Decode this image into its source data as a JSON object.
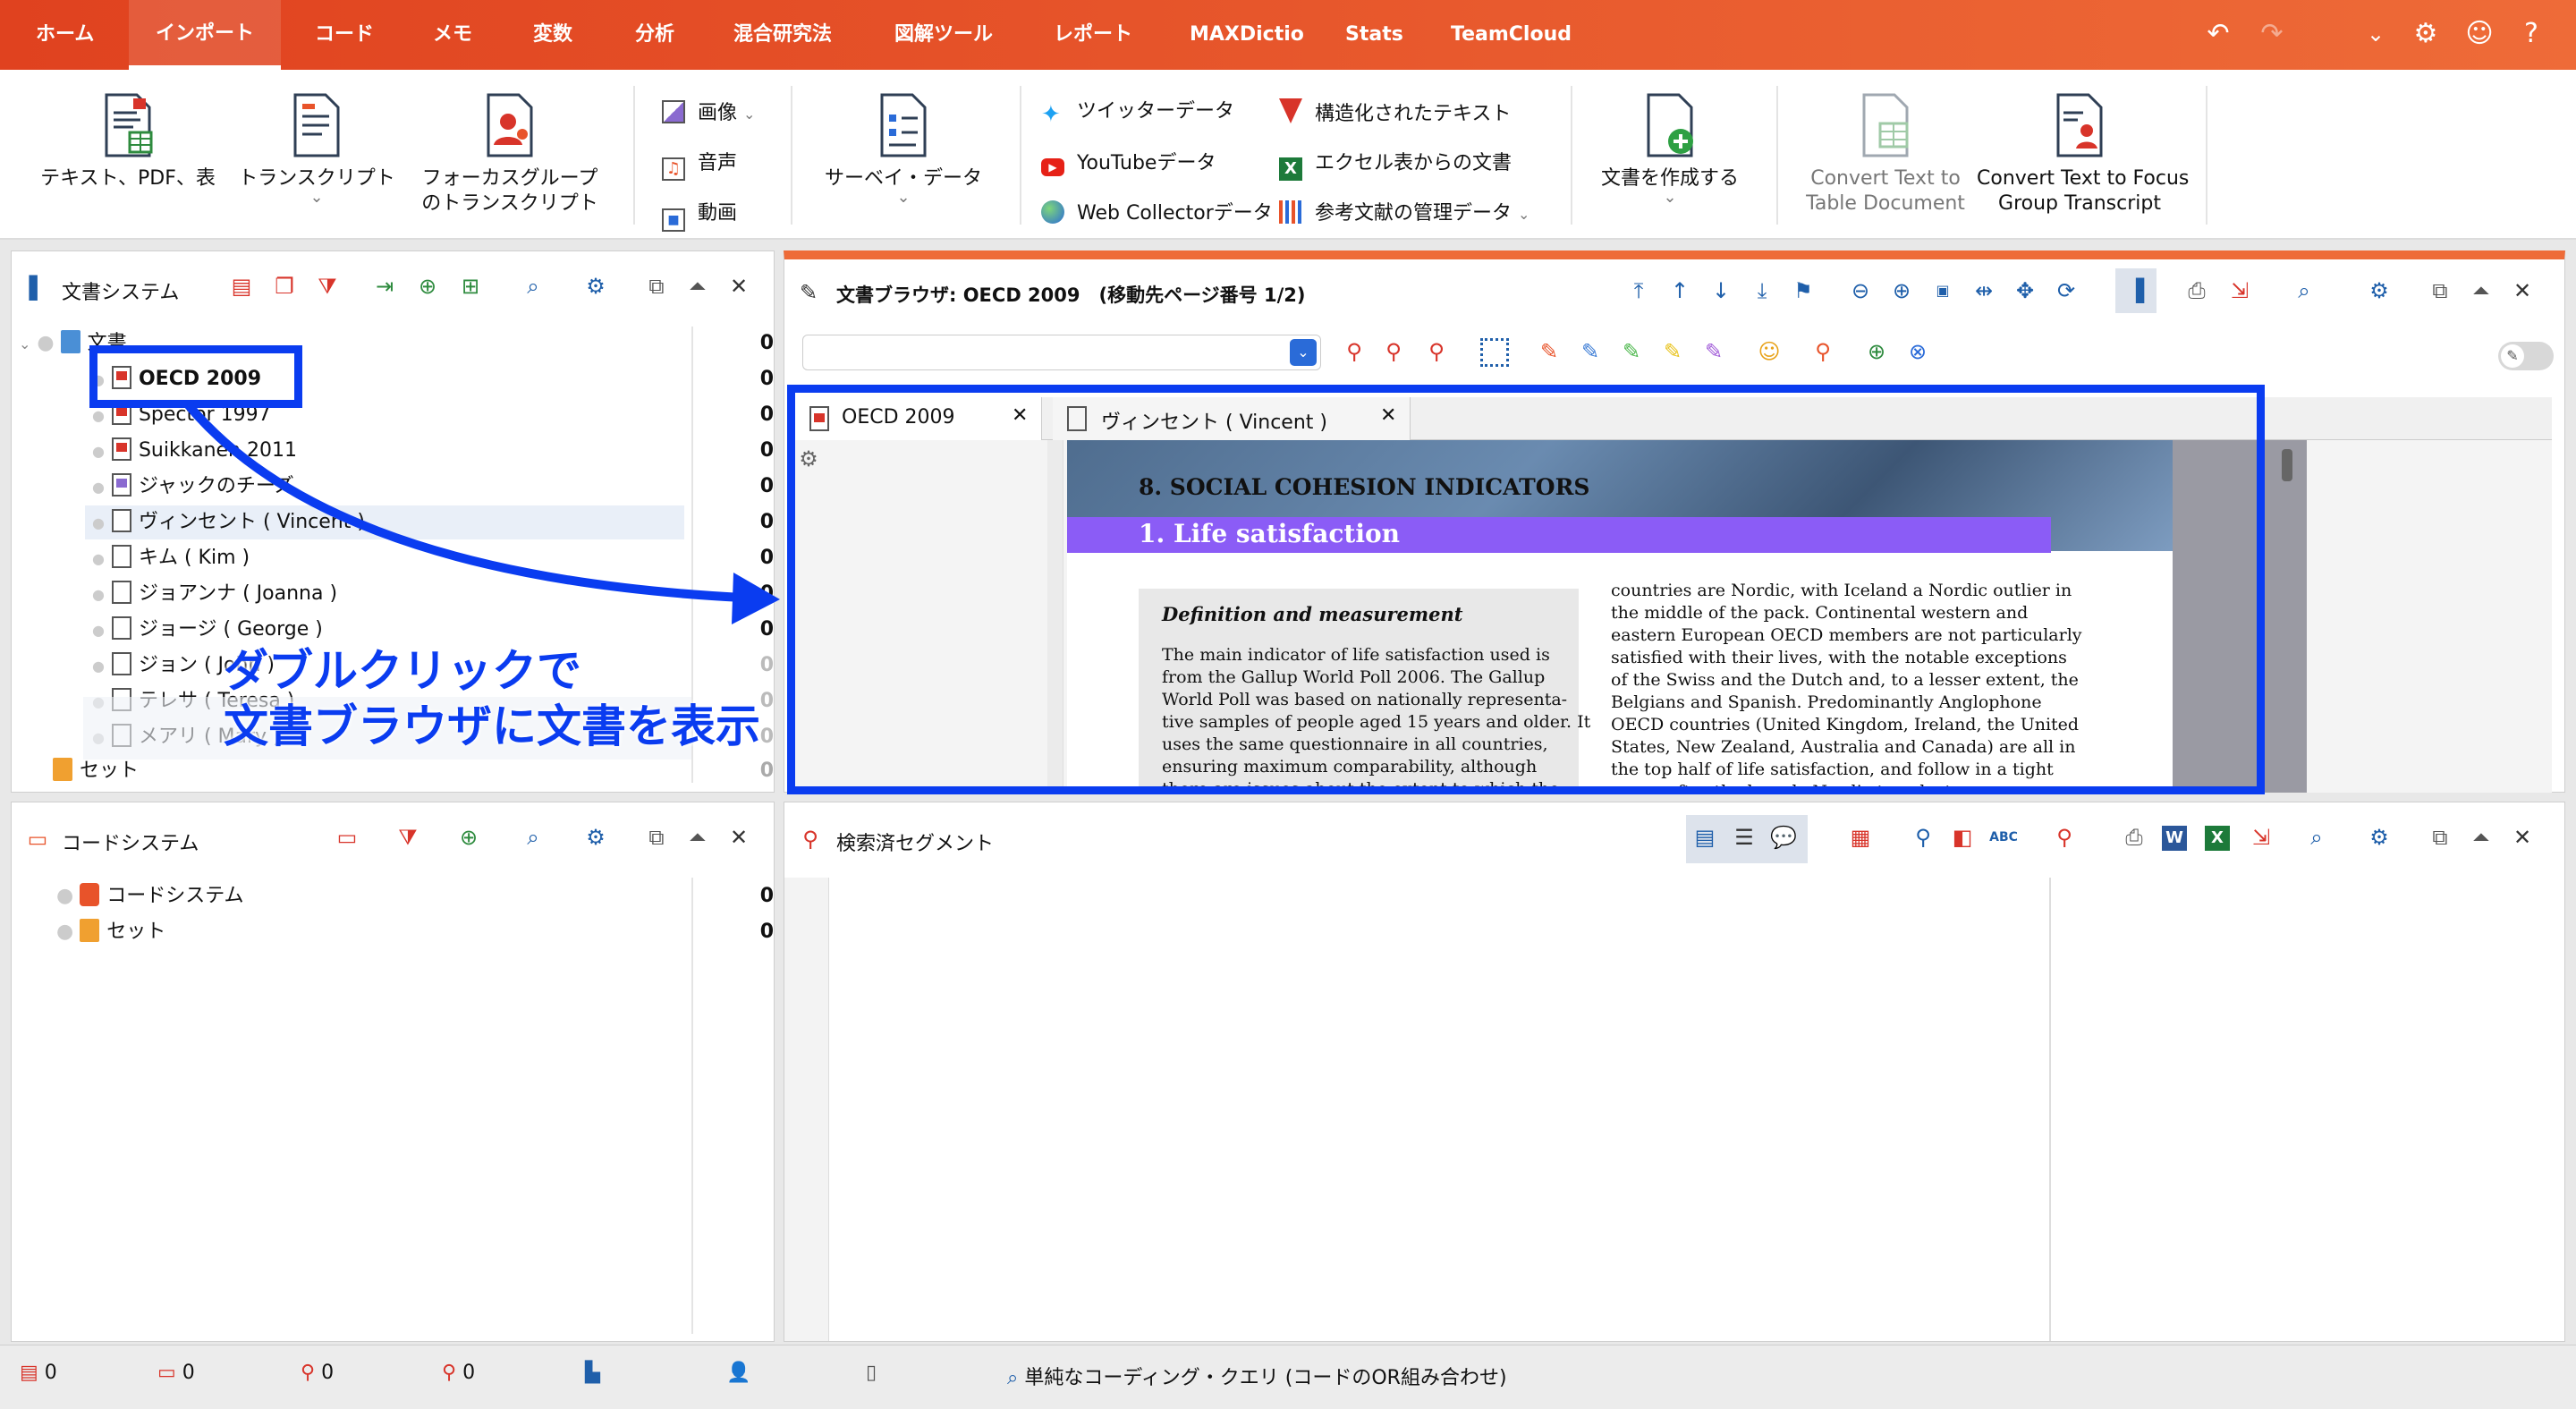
{
  "menubar": {
    "items": [
      "ホーム",
      "インポート",
      "コード",
      "メモ",
      "変数",
      "分析",
      "混合研究法",
      "図解ツール",
      "レポート",
      "MAXDictio",
      "Stats",
      "TeamCloud"
    ],
    "active": "インポート"
  },
  "ribbon": {
    "text_pdf": "テキスト、PDF、表",
    "transcript": "トランスクリプト",
    "focus_group_1": "フォーカスグループ",
    "focus_group_2": "のトランスクリプト",
    "image": "画像",
    "audio": "音声",
    "video": "動画",
    "survey": "サーベイ・データ",
    "twitter": "ツイッターデータ",
    "youtube": "YouTubeデータ",
    "webcollector": "Web Collectorデータ",
    "structured": "構造化されたテキスト",
    "excel_docs": "エクセル表からの文書",
    "refmgr": "参考文献の管理データ",
    "create_doc": "文書を作成する",
    "convert_table_1": "Convert Text to",
    "convert_table_2": "Table Document",
    "convert_focus_1": "Convert Text to Focus",
    "convert_focus_2": "Group Transcript"
  },
  "doc_system": {
    "title": "文書システム",
    "root": "文書",
    "root_count": "0",
    "items": [
      {
        "label": "OECD 2009",
        "count": "0"
      },
      {
        "label": "Spector 1997",
        "count": "0"
      },
      {
        "label": "Suikkanen 2011",
        "count": "0"
      },
      {
        "label": "ジャックのチーズ",
        "count": "0"
      },
      {
        "label": "ヴィンセント ( Vincent )",
        "count": "0"
      },
      {
        "label": "キム ( Kim )",
        "count": "0"
      },
      {
        "label": "ジョアンナ ( Joanna )",
        "count": "0"
      },
      {
        "label": "ジョージ ( George )",
        "count": "0"
      },
      {
        "label": "ジョン ( John )",
        "count": "0"
      },
      {
        "label": "テレサ ( Teresa )",
        "count": "0"
      },
      {
        "label": "メアリ ( Mary )",
        "count": "0"
      }
    ],
    "set_label": "セット",
    "set_count": "0"
  },
  "annotation": {
    "line1": "ダブルクリックで",
    "line2": "文書ブラウザに文書を表示",
    "color": "#0a3cf0"
  },
  "doc_browser": {
    "title": "文書ブラウザ: OECD 2009　(移動先ページ番号 1/2)",
    "tabs": [
      "OECD 2009",
      "ヴィンセント ( Vincent )"
    ],
    "page": {
      "chapter": "8.  SOCIAL COHESION INDICATORS",
      "section": "1. Life satisfaction",
      "box_title": "Definition and measurement",
      "left_lines": [
        "The main indicator of life satisfaction used is",
        "from the Gallup World Poll 2006. The Gallup",
        "World Poll was based on nationally representa-",
        "tive samples of people aged 15 years and older. It",
        "uses the same questionnaire in all countries,",
        "ensuring maximum comparability, although",
        "there are issues about the extent to which the"
      ],
      "right_lines": [
        "countries are Nordic, with Iceland a Nordic outlier in",
        "the middle of the pack. Continental western and",
        "eastern European OECD members are not particularly",
        "satisfied with their lives, with the notable exceptions",
        "of the Swiss and the Dutch and, to a lesser extent, the",
        "Belgians and Spanish. Predominantly Anglophone",
        "OECD countries (United Kingdom, Ireland, the United",
        "States, New Zealand, Australia and Canada) are all in",
        "the top half of life satisfaction, and follow in a tight",
        "group after the largely Nordic top cluster."
      ]
    }
  },
  "code_system": {
    "title": "コードシステム",
    "root": "コードシステム",
    "root_count": "0",
    "set_label": "セット",
    "set_count": "0"
  },
  "retrieved": {
    "title": "検索済セグメント"
  },
  "status": {
    "docs": "0",
    "codes": "0",
    "segments": "0",
    "activated": "0",
    "query": "単純なコーディング・クエリ (コードのOR組み合わせ)"
  },
  "colors": {
    "accent": "#e8532a",
    "highlight_blue": "#0a3cf0",
    "section_purple": "#8b5cf6"
  }
}
